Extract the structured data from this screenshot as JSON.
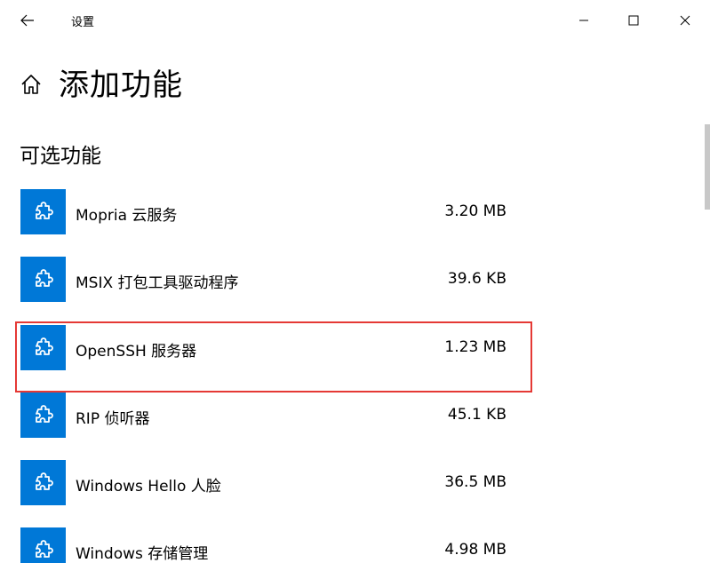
{
  "window": {
    "title": "设置",
    "controls": {
      "minimize": "minimize",
      "maximize": "maximize",
      "close": "close"
    }
  },
  "header": {
    "title": "添加功能",
    "icon": "home-icon"
  },
  "section": {
    "title": "可选功能"
  },
  "features": [
    {
      "name": "Mopria 云服务",
      "size": "3.20 MB",
      "icon": "puzzle-icon"
    },
    {
      "name": "MSIX 打包工具驱动程序",
      "size": "39.6 KB",
      "icon": "puzzle-icon"
    },
    {
      "name": "OpenSSH 服务器",
      "size": "1.23 MB",
      "icon": "puzzle-icon",
      "highlighted": true
    },
    {
      "name": "RIP 侦听器",
      "size": "45.1 KB",
      "icon": "puzzle-icon"
    },
    {
      "name": "Windows Hello 人脸",
      "size": "36.5 MB",
      "icon": "puzzle-icon"
    },
    {
      "name": "Windows 存储管理",
      "size": "4.98 MB",
      "icon": "puzzle-icon"
    }
  ],
  "colors": {
    "accent": "#0078d7",
    "highlight": "#e53935"
  }
}
